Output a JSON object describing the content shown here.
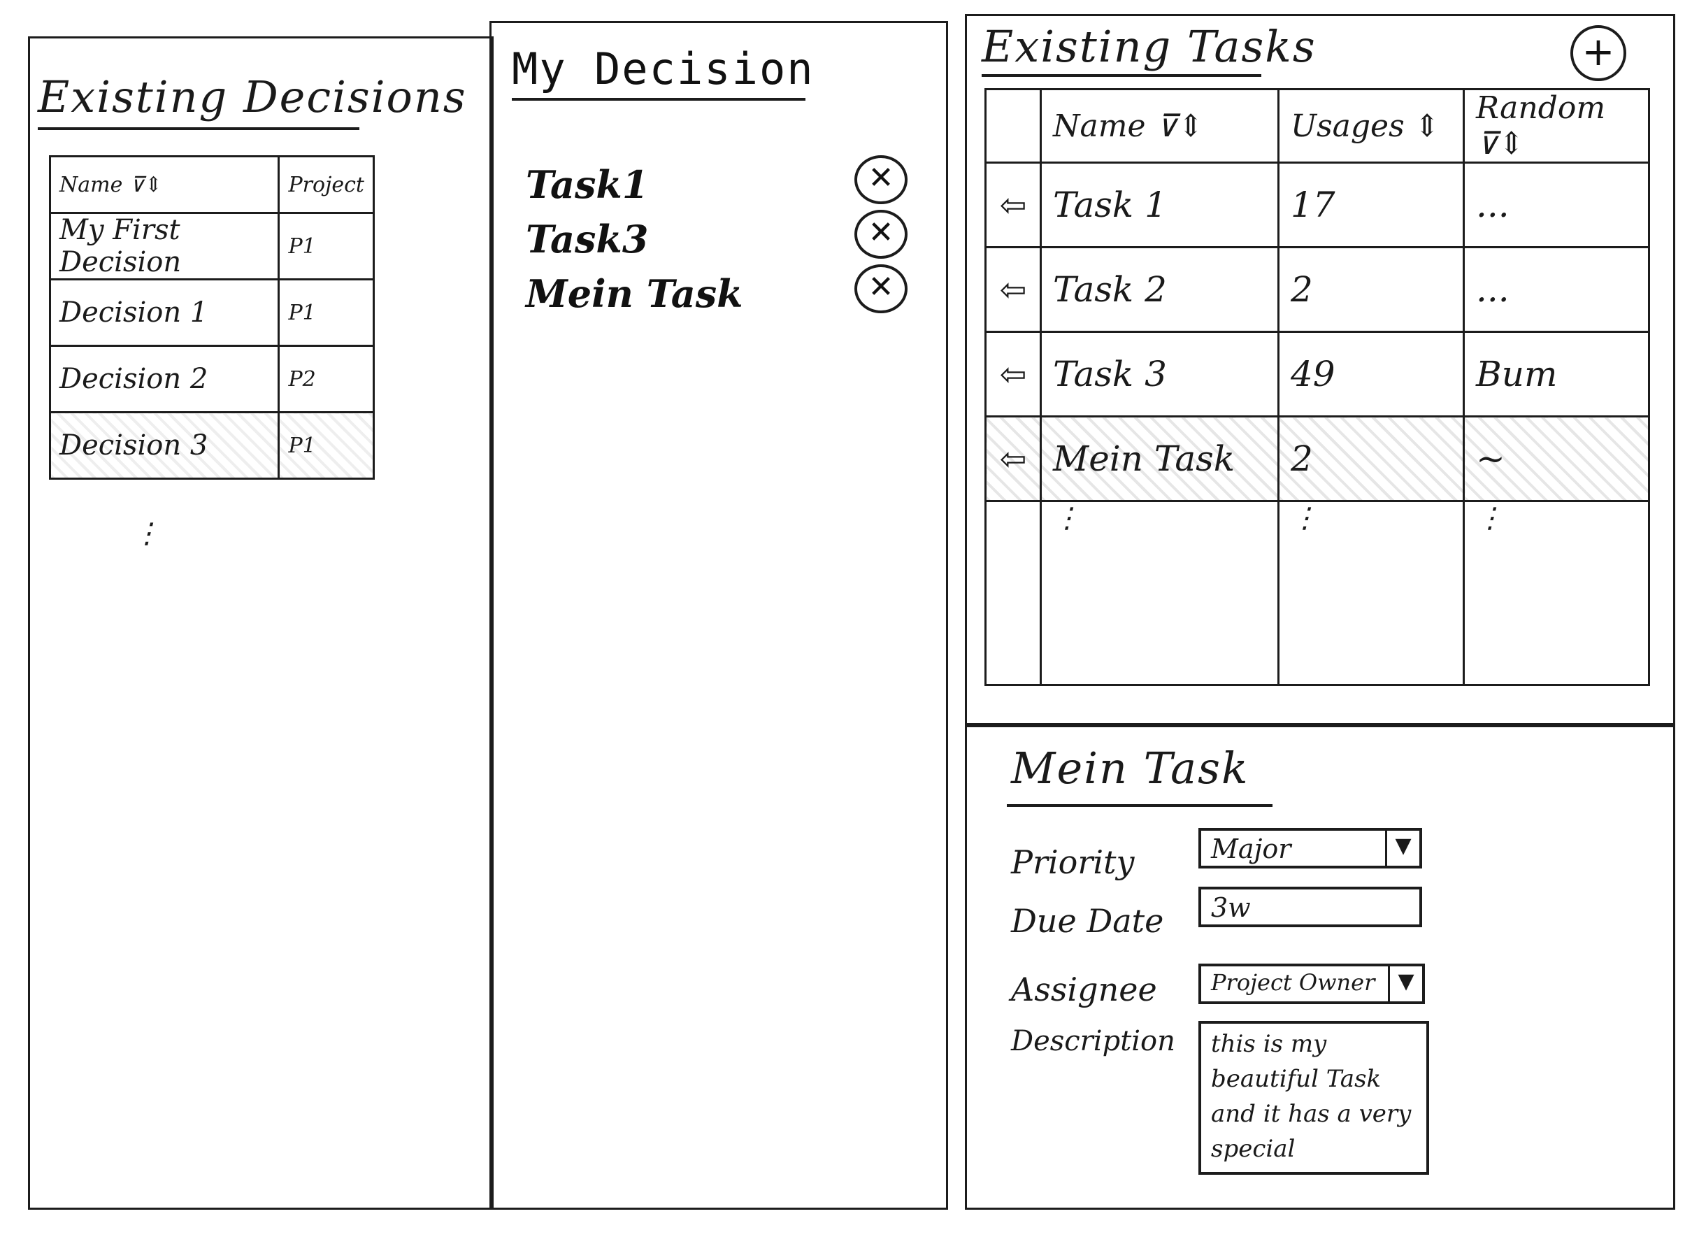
{
  "decisions_panel": {
    "title": "Existing Decisions",
    "columns": {
      "name": "Name ⊽⇕",
      "project": "Project"
    },
    "rows": [
      {
        "name": "My First Decision",
        "project": "P1",
        "selected": false
      },
      {
        "name": "Decision 1",
        "project": "P1",
        "selected": false
      },
      {
        "name": "Decision 2",
        "project": "P2",
        "selected": false
      },
      {
        "name": "Decision 3",
        "project": "P1",
        "selected": true
      }
    ],
    "more": "⋮"
  },
  "decision_panel": {
    "title": "My Decision",
    "tasks": [
      {
        "label": "Task1",
        "remove_icon": "✕"
      },
      {
        "label": "Task3",
        "remove_icon": "✕"
      },
      {
        "label": "Mein Task",
        "remove_icon": "✕"
      }
    ]
  },
  "tasks_panel": {
    "title": "Existing Tasks",
    "add_icon": "+",
    "columns": {
      "name": "Name ⊽⇕",
      "usages": "Usages ⇕",
      "random": "Random ⊽⇕"
    },
    "rows": [
      {
        "arrow": "⇦",
        "name": "Task 1",
        "usages": "17",
        "random": "..."
      },
      {
        "arrow": "⇦",
        "name": "Task 2",
        "usages": "2",
        "random": "..."
      },
      {
        "arrow": "⇦",
        "name": "Task 3",
        "usages": "49",
        "random": "Bum"
      },
      {
        "arrow": "⇦",
        "name": "Mein Task",
        "usages": "2",
        "random": "~",
        "selected": true
      }
    ],
    "more": "⋮"
  },
  "task_detail": {
    "title": "Mein Task",
    "priority_label": "Priority",
    "priority_value": "Major",
    "due_label": "Due Date",
    "due_value": "3w",
    "assignee_label": "Assignee",
    "assignee_value": "Project Owner",
    "description_label": "Description",
    "description_value": "this is my beautiful Task and it has a very special",
    "dropdown_icon": "▼"
  }
}
